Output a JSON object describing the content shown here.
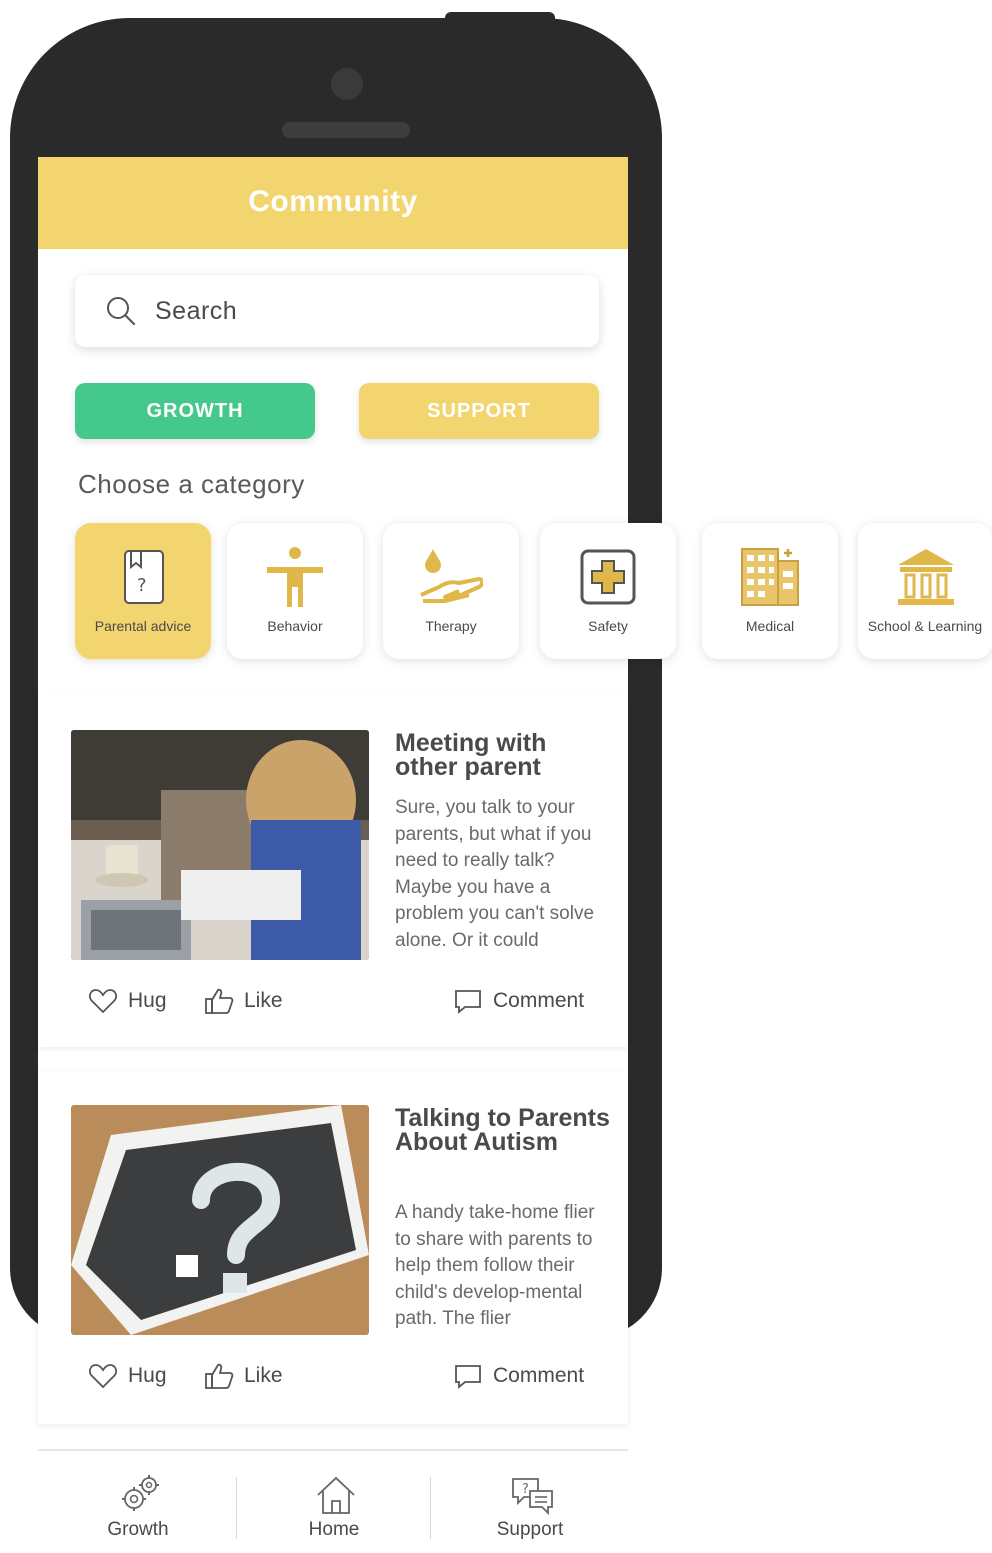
{
  "header": {
    "title": "Community"
  },
  "search": {
    "placeholder": "Search"
  },
  "buttons": {
    "growth": "GROWTH",
    "support": "SUPPORT"
  },
  "category_heading": "Choose a category",
  "categories": [
    {
      "label": "Parental advice",
      "icon": "question-book-icon",
      "active": true
    },
    {
      "label": "Behavior",
      "icon": "person-icon",
      "active": false
    },
    {
      "label": "Therapy",
      "icon": "hand-drop-icon",
      "active": false
    },
    {
      "label": "Safety",
      "icon": "first-aid-icon",
      "active": false
    },
    {
      "label": "Medical",
      "icon": "hospital-icon",
      "active": false
    },
    {
      "label": "School & Learning",
      "icon": "school-icon",
      "active": false
    }
  ],
  "posts": [
    {
      "title": "Meeting with other parent",
      "body": "Sure, you talk to your parents, but what if you need to really talk? Maybe you have a problem you can't solve alone. Or it could",
      "image": "people-at-table-photo"
    },
    {
      "title": "Talking to Parents About Autism",
      "body": "A handy take-home flier to share with parents to help them follow their child's develop-mental path. The flier",
      "image": "question-mark-chalkboard-photo"
    }
  ],
  "actions": {
    "hug": "Hug",
    "like": "Like",
    "comment": "Comment"
  },
  "nav": [
    {
      "label": "Growth",
      "icon": "gears-icon"
    },
    {
      "label": "Home",
      "icon": "home-icon"
    },
    {
      "label": "Support",
      "icon": "chat-support-icon"
    }
  ],
  "colors": {
    "header": "#f3d56f",
    "growth": "#45c88b",
    "support": "#f3d56f",
    "phone": "#2a2a2a"
  }
}
